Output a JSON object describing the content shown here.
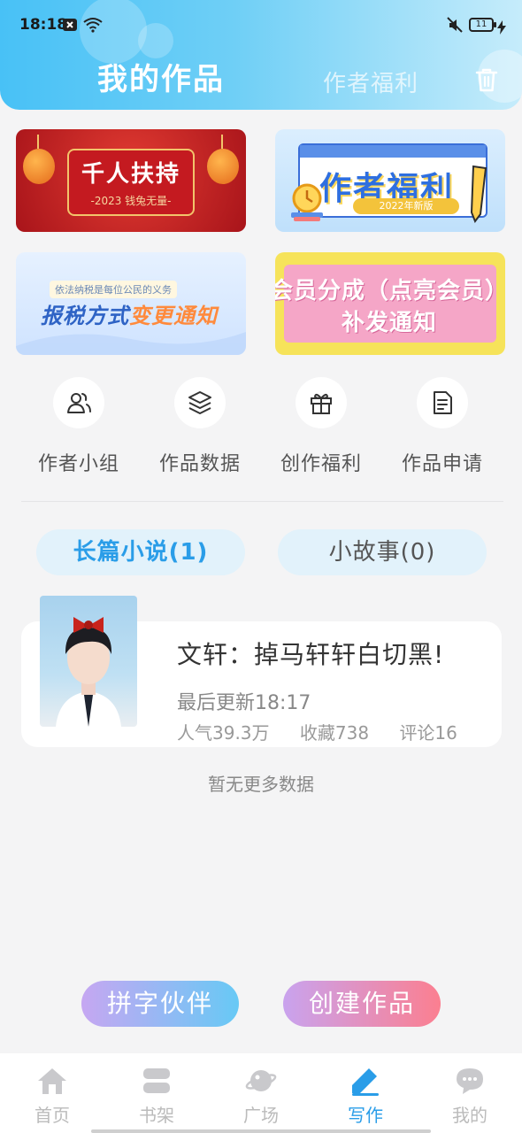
{
  "status_bar": {
    "time": "18:18",
    "battery": "11"
  },
  "header": {
    "title": "我的作品",
    "subtitle_tab": "作者福利"
  },
  "banners": [
    {
      "title": "千人扶持",
      "subtitle": "-2023 钱兔无量-"
    },
    {
      "title": "作者福利",
      "subtitle": "2022年新版"
    },
    {
      "tag": "依法纳税是每位公民的义务",
      "title_part1": "报税方式",
      "title_part2": "变更通知"
    },
    {
      "title": "会员分成（点亮会员）补发通知"
    }
  ],
  "quick_actions": [
    {
      "label": "作者小组",
      "icon": "users-icon"
    },
    {
      "label": "作品数据",
      "icon": "layers-icon"
    },
    {
      "label": "创作福利",
      "icon": "gift-icon"
    },
    {
      "label": "作品申请",
      "icon": "document-icon"
    }
  ],
  "tabs": [
    {
      "label": "长篇小说(1)",
      "active": true
    },
    {
      "label": "小故事(0)",
      "active": false
    }
  ],
  "work": {
    "title": "文轩：掉马轩轩白切黑!",
    "last_update": "最后更新18:17",
    "popularity": "人气39.3万",
    "favorites": "收藏738",
    "comments": "评论16"
  },
  "no_more_text": "暂无更多数据",
  "buttons": {
    "partner": "拼字伙伴",
    "create": "创建作品"
  },
  "nav": [
    {
      "label": "首页",
      "icon": "home-icon"
    },
    {
      "label": "书架",
      "icon": "bookshelf-icon"
    },
    {
      "label": "广场",
      "icon": "planet-icon"
    },
    {
      "label": "写作",
      "icon": "pen-icon",
      "active": true
    },
    {
      "label": "我的",
      "icon": "chat-icon"
    }
  ],
  "colors": {
    "accent": "#2a9de8",
    "header_start": "#48c1f6"
  }
}
